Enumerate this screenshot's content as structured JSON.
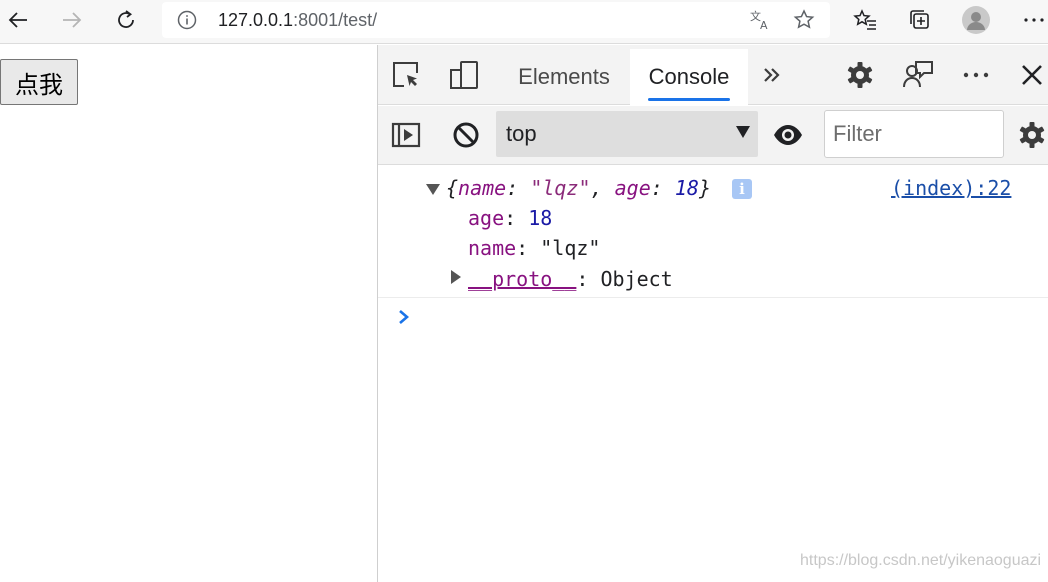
{
  "browser": {
    "url_host": "127.0.0.1",
    "url_rest": ":8001/test/",
    "icons": [
      "back-icon",
      "forward-icon",
      "refresh-icon",
      "info-icon",
      "translate-icon",
      "star-icon",
      "favorites-icon",
      "collections-icon",
      "profile-icon",
      "more-icon"
    ]
  },
  "page": {
    "button_label": "点我"
  },
  "devtools": {
    "tabs": [
      "Elements",
      "Console"
    ],
    "active_tab": "Console",
    "context": "top",
    "filter_placeholder": "Filter",
    "console": {
      "preview_open": "{",
      "k_name": "name",
      "sep1": ": ",
      "v_name": "\"lqz\"",
      "comma": ", ",
      "k_age": "age",
      "sep2": ": ",
      "v_age": "18",
      "preview_close": "}",
      "source_link": "(index):22",
      "props": [
        {
          "key": "age",
          "sep": ": ",
          "value": "18"
        },
        {
          "key": "name",
          "sep": ": ",
          "value": "\"lqz\""
        },
        {
          "key": "__proto__",
          "sep": ": ",
          "value": "Object"
        }
      ],
      "info_badge": "i"
    }
  },
  "watermark": "https://blog.csdn.net/yikenaoguazi",
  "colors": {
    "accent": "#1a73e8",
    "key": "#881280",
    "number": "#1a1aa6",
    "link": "#1a4ea8"
  }
}
